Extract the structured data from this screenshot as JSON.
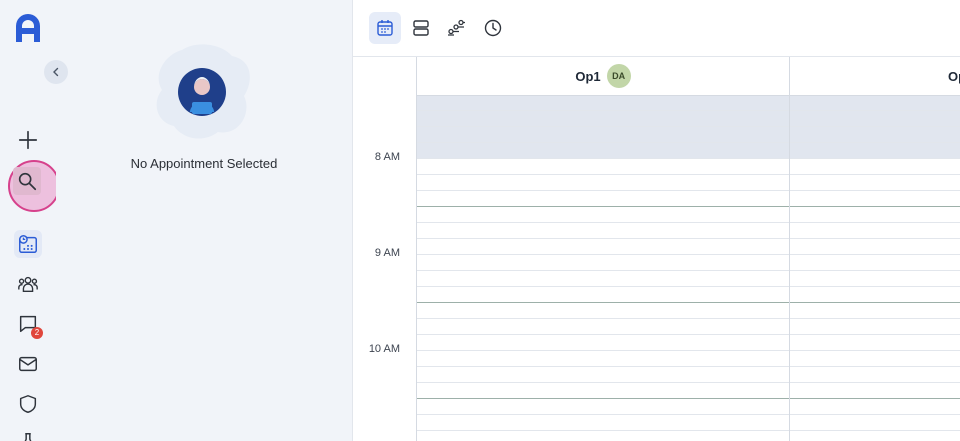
{
  "rail": {
    "items": [
      {
        "name": "add-icon"
      },
      {
        "name": "search-icon"
      },
      {
        "name": "schedule-icon"
      },
      {
        "name": "patients-icon"
      },
      {
        "name": "messages-icon",
        "badge": "2"
      },
      {
        "name": "mail-icon"
      },
      {
        "name": "shield-icon"
      }
    ]
  },
  "panel": {
    "empty_text": "No Appointment Selected"
  },
  "toolbar": {
    "views": [
      "calendar-view-icon",
      "list-view-icon",
      "team-view-icon",
      "clock-icon"
    ]
  },
  "calendar": {
    "times": [
      "8 AM",
      "9 AM",
      "10 AM"
    ],
    "operatories": [
      {
        "name": "Op1",
        "initials": "DA"
      },
      {
        "name": "Op"
      }
    ]
  },
  "colors": {
    "accent": "#2b5cd6",
    "highlight_ring": "#d6418c",
    "badge": "#e0463c",
    "avatar": "#c2d6a8",
    "blocked_slot": "#e1e6ef"
  }
}
